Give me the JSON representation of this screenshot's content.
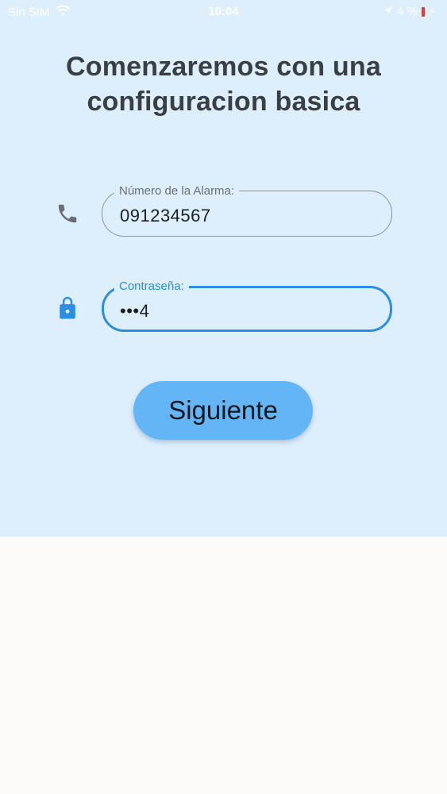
{
  "status_bar": {
    "carrier": "Sin SIM",
    "time": "10:04",
    "battery_percent": "4 %"
  },
  "title": {
    "line1": "Comenzaremos con una",
    "line2": "configuracion basica"
  },
  "form": {
    "alarm_number": {
      "label": "Número de la Alarma:",
      "value": "091234567"
    },
    "password": {
      "label": "Contraseña:",
      "value": "•••4"
    }
  },
  "next_button": {
    "label": "Siguiente"
  },
  "colors": {
    "background_top": "#ddeefd",
    "background_bottom": "#fcfbfa",
    "accent": "#2a8ee6",
    "button": "#64b5f6",
    "icon_gray": "#6b6f74"
  },
  "icons": {
    "phone": "phone-icon",
    "password": "lock-icon",
    "wifi": "wifi-icon",
    "location": "location-icon",
    "battery": "battery-icon",
    "charging": "charging-icon"
  }
}
